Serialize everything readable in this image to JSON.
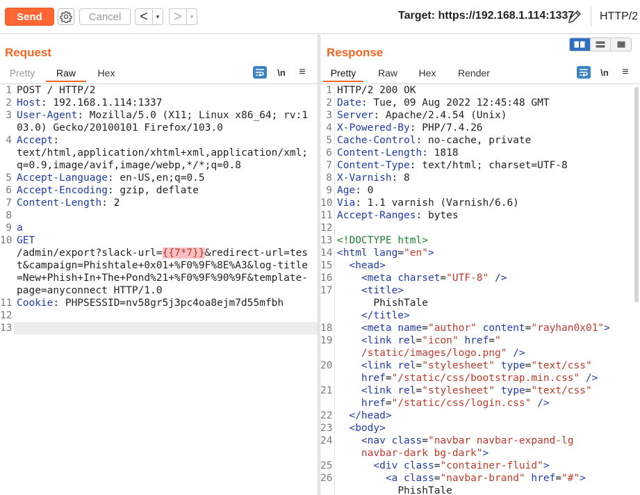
{
  "toolbar": {
    "send_label": "Send",
    "cancel_label": "Cancel",
    "back_arrow": "<",
    "forward_arrow": ">",
    "dropdown_glyph": "▾",
    "target_label": "Target: https://192.168.1.114:1337",
    "http_version": "HTTP/2"
  },
  "request": {
    "title": "Request",
    "tabs": [
      {
        "label": "Pretty",
        "state": "disabled"
      },
      {
        "label": "Raw",
        "state": "active"
      },
      {
        "label": "Hex",
        "state": "normal"
      }
    ],
    "newline_toggle": "\\n",
    "menu_glyph": "≡",
    "lines": [
      {
        "n": "1",
        "segs": [
          {
            "t": "POST / HTTP/2"
          }
        ]
      },
      {
        "n": "2",
        "segs": [
          {
            "t": "Host",
            "c": "hk"
          },
          {
            "t": ": 192.168.1.114:1337"
          }
        ]
      },
      {
        "n": "3",
        "segs": [
          {
            "t": "User-Agent",
            "c": "hk"
          },
          {
            "t": ": Mozilla/5.0 (X11; Linux x86_64; rv:103.0) Gecko/20100101 Firefox/103.0"
          }
        ]
      },
      {
        "n": "4",
        "segs": [
          {
            "t": "Accept",
            "c": "hk"
          },
          {
            "t": ":\ntext/html,application/xhtml+xml,application/xml;q=0.9,image/avif,image/webp,*/*;q=0.8"
          }
        ]
      },
      {
        "n": "5",
        "segs": [
          {
            "t": "Accept-Language",
            "c": "hk"
          },
          {
            "t": ": en-US,en;q=0.5"
          }
        ]
      },
      {
        "n": "6",
        "segs": [
          {
            "t": "Accept-Encoding",
            "c": "hk"
          },
          {
            "t": ": gzip, deflate"
          }
        ]
      },
      {
        "n": "7",
        "segs": [
          {
            "t": "Content-Length",
            "c": "hk"
          },
          {
            "t": ": 2"
          }
        ]
      },
      {
        "n": "8",
        "segs": [
          {
            "t": " "
          }
        ]
      },
      {
        "n": "9",
        "segs": [
          {
            "t": "a",
            "c": "blue"
          }
        ]
      },
      {
        "n": "10",
        "segs": [
          {
            "t": "GET",
            "c": "blue"
          },
          {
            "t": "\n/admin/export?slack-url="
          },
          {
            "t": "{{7*7}}",
            "c": "hl"
          },
          {
            "t": "&redirect-url=test&campaign=Phishtale+0x01+%F0%9F%8E%A3&log-title=New+Phish+In+The+Pond%21+%F0%9F%90%9F&template-page=anyconnect HTTP/1.0"
          }
        ]
      },
      {
        "n": "11",
        "segs": [
          {
            "t": "Cookie",
            "c": "hk"
          },
          {
            "t": ": PHPSESSID=nv58gr5j3pc4oa8ejm7d55mfbh"
          }
        ]
      },
      {
        "n": "12",
        "segs": [
          {
            "t": " "
          }
        ]
      },
      {
        "n": "13",
        "segs": [
          {
            "t": " "
          }
        ],
        "current": true
      }
    ]
  },
  "response": {
    "title": "Response",
    "tabs": [
      {
        "label": "Pretty",
        "state": "active"
      },
      {
        "label": "Raw",
        "state": "normal"
      },
      {
        "label": "Hex",
        "state": "normal"
      },
      {
        "label": "Render",
        "state": "normal"
      }
    ],
    "newline_toggle": "\\n",
    "menu_glyph": "≡",
    "lines": [
      {
        "n": "1",
        "segs": [
          {
            "t": "HTTP/2 200 OK"
          }
        ]
      },
      {
        "n": "2",
        "segs": [
          {
            "t": "Date",
            "c": "hk"
          },
          {
            "t": ": Tue, 09 Aug 2022 12:45:48 GMT"
          }
        ]
      },
      {
        "n": "3",
        "segs": [
          {
            "t": "Server",
            "c": "hk"
          },
          {
            "t": ": Apache/2.4.54 (Unix)"
          }
        ]
      },
      {
        "n": "4",
        "segs": [
          {
            "t": "X-Powered-By",
            "c": "hk"
          },
          {
            "t": ": PHP/7.4.26"
          }
        ]
      },
      {
        "n": "5",
        "segs": [
          {
            "t": "Cache-Control",
            "c": "hk"
          },
          {
            "t": ": no-cache, private"
          }
        ]
      },
      {
        "n": "6",
        "segs": [
          {
            "t": "Content-Length",
            "c": "hk"
          },
          {
            "t": ": 1818"
          }
        ]
      },
      {
        "n": "7",
        "segs": [
          {
            "t": "Content-Type",
            "c": "hk"
          },
          {
            "t": ": text/html; charset=UTF-8"
          }
        ]
      },
      {
        "n": "8",
        "segs": [
          {
            "t": "X-Varnish",
            "c": "hk"
          },
          {
            "t": ": 8"
          }
        ]
      },
      {
        "n": "9",
        "segs": [
          {
            "t": "Age",
            "c": "hk"
          },
          {
            "t": ": 0"
          }
        ]
      },
      {
        "n": "10",
        "segs": [
          {
            "t": "Via",
            "c": "hk"
          },
          {
            "t": ": 1.1 varnish (Varnish/6.6)"
          }
        ]
      },
      {
        "n": "11",
        "segs": [
          {
            "t": "Accept-Ranges",
            "c": "hk"
          },
          {
            "t": ": bytes"
          }
        ]
      },
      {
        "n": "12",
        "segs": [
          {
            "t": " "
          }
        ]
      },
      {
        "n": "13",
        "segs": [
          {
            "t": "<!DOCTYPE html>",
            "c": "doctype"
          }
        ]
      },
      {
        "n": "14",
        "segs": [
          {
            "t": "<html ",
            "c": "tag"
          },
          {
            "t": "lang",
            "c": "attr"
          },
          {
            "t": "="
          },
          {
            "t": "\"en\"",
            "c": "str"
          },
          {
            "t": ">",
            "c": "tag"
          }
        ]
      },
      {
        "n": "15",
        "segs": [
          {
            "t": "  "
          },
          {
            "t": "<head>",
            "c": "tag"
          }
        ]
      },
      {
        "n": "16",
        "segs": [
          {
            "t": "    "
          },
          {
            "t": "<meta ",
            "c": "tag"
          },
          {
            "t": "charset",
            "c": "attr"
          },
          {
            "t": "="
          },
          {
            "t": "\"UTF-8\"",
            "c": "str"
          },
          {
            "t": " />",
            "c": "tag"
          }
        ]
      },
      {
        "n": "17",
        "segs": [
          {
            "t": "    "
          },
          {
            "t": "<title>",
            "c": "tag"
          },
          {
            "t": "\n      PhishTale\n    "
          },
          {
            "t": "</title>",
            "c": "tag"
          }
        ]
      },
      {
        "n": "18",
        "segs": [
          {
            "t": "    "
          },
          {
            "t": "<meta ",
            "c": "tag"
          },
          {
            "t": "name",
            "c": "attr"
          },
          {
            "t": "="
          },
          {
            "t": "\"author\"",
            "c": "str"
          },
          {
            "t": " "
          },
          {
            "t": "content",
            "c": "attr"
          },
          {
            "t": "="
          },
          {
            "t": "\"rayhan0x01\"",
            "c": "str"
          },
          {
            "t": ">",
            "c": "tag"
          }
        ]
      },
      {
        "n": "19",
        "segs": [
          {
            "t": "    "
          },
          {
            "t": "<link ",
            "c": "tag"
          },
          {
            "t": "rel",
            "c": "attr"
          },
          {
            "t": "="
          },
          {
            "t": "\"icon\"",
            "c": "str"
          },
          {
            "t": " "
          },
          {
            "t": "href",
            "c": "attr"
          },
          {
            "t": "="
          },
          {
            "t": "\"\n    /static/images/logo.png\"",
            "c": "str"
          },
          {
            "t": " />",
            "c": "tag"
          }
        ]
      },
      {
        "n": "20",
        "segs": [
          {
            "t": "    "
          },
          {
            "t": "<link ",
            "c": "tag"
          },
          {
            "t": "rel",
            "c": "attr"
          },
          {
            "t": "="
          },
          {
            "t": "\"stylesheet\"",
            "c": "str"
          },
          {
            "t": " "
          },
          {
            "t": "type",
            "c": "attr"
          },
          {
            "t": "="
          },
          {
            "t": "\"text/css\"",
            "c": "str"
          },
          {
            "t": "\n    "
          },
          {
            "t": "href",
            "c": "attr"
          },
          {
            "t": "="
          },
          {
            "t": "\"/static/css/bootstrap.min.css\"",
            "c": "str"
          },
          {
            "t": " />",
            "c": "tag"
          }
        ]
      },
      {
        "n": "21",
        "segs": [
          {
            "t": "    "
          },
          {
            "t": "<link ",
            "c": "tag"
          },
          {
            "t": "rel",
            "c": "attr"
          },
          {
            "t": "="
          },
          {
            "t": "\"stylesheet\"",
            "c": "str"
          },
          {
            "t": " "
          },
          {
            "t": "type",
            "c": "attr"
          },
          {
            "t": "="
          },
          {
            "t": "\"text/css\"",
            "c": "str"
          },
          {
            "t": "\n    "
          },
          {
            "t": "href",
            "c": "attr"
          },
          {
            "t": "="
          },
          {
            "t": "\"/static/css/login.css\"",
            "c": "str"
          },
          {
            "t": " />",
            "c": "tag"
          }
        ]
      },
      {
        "n": "22",
        "segs": [
          {
            "t": "  "
          },
          {
            "t": "</head>",
            "c": "tag"
          }
        ]
      },
      {
        "n": "23",
        "segs": [
          {
            "t": "  "
          },
          {
            "t": "<body>",
            "c": "tag"
          }
        ]
      },
      {
        "n": "24",
        "segs": [
          {
            "t": "    "
          },
          {
            "t": "<nav ",
            "c": "tag"
          },
          {
            "t": "class",
            "c": "attr"
          },
          {
            "t": "="
          },
          {
            "t": "\"navbar navbar-expand-lg\n    navbar-dark bg-dark\"",
            "c": "str"
          },
          {
            "t": ">",
            "c": "tag"
          }
        ]
      },
      {
        "n": "25",
        "segs": [
          {
            "t": "      "
          },
          {
            "t": "<div ",
            "c": "tag"
          },
          {
            "t": "class",
            "c": "attr"
          },
          {
            "t": "="
          },
          {
            "t": "\"container-fluid\"",
            "c": "str"
          },
          {
            "t": ">",
            "c": "tag"
          }
        ]
      },
      {
        "n": "26",
        "segs": [
          {
            "t": "        "
          },
          {
            "t": "<a ",
            "c": "tag"
          },
          {
            "t": "class",
            "c": "attr"
          },
          {
            "t": "="
          },
          {
            "t": "\"navbar-brand\"",
            "c": "str"
          },
          {
            "t": " "
          },
          {
            "t": "href",
            "c": "attr"
          },
          {
            "t": "="
          },
          {
            "t": "\"#\"",
            "c": "str"
          },
          {
            "t": ">",
            "c": "tag"
          },
          {
            "t": "\n          PhishTale"
          }
        ]
      }
    ]
  },
  "colors": {
    "accent": "#f26522",
    "send_button": "#ff6633",
    "header_key": "#1f3ba8",
    "string": "#c0392b",
    "doctype": "#1a7f37",
    "highlight": "#f8c0c0"
  },
  "icons": [
    "gear-icon",
    "back-arrow-icon",
    "forward-arrow-icon",
    "edit-pencil-icon",
    "wrap-lines-icon",
    "newline-toggle-icon",
    "hamburger-menu-icon",
    "layout-side-by-side-icon",
    "layout-top-bottom-icon",
    "layout-single-icon"
  ]
}
